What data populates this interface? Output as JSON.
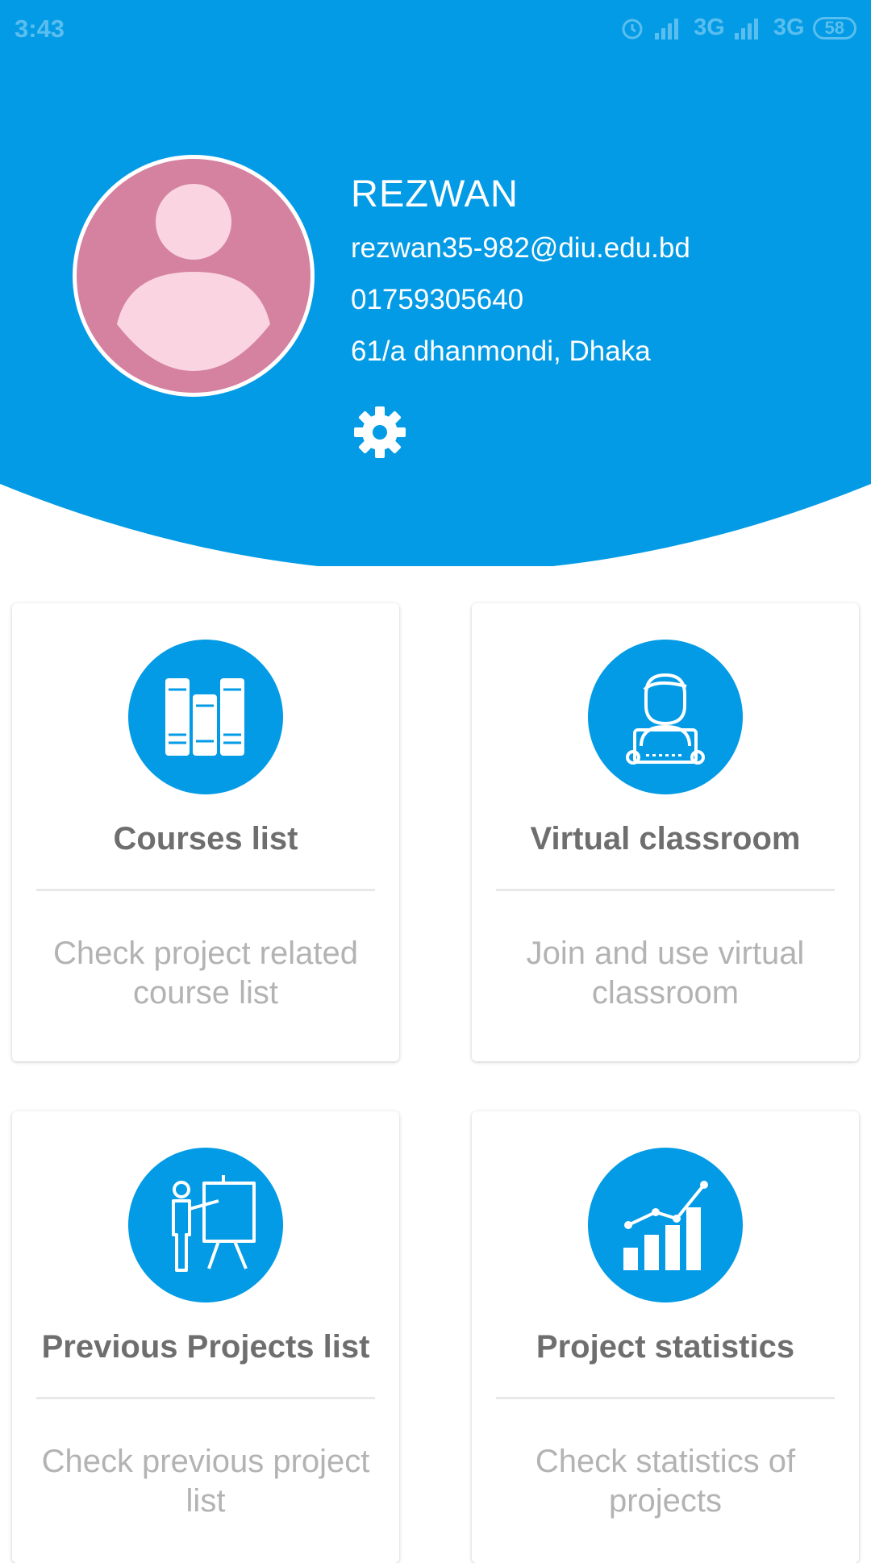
{
  "status_bar": {
    "time": "3:43",
    "network_1": "3G",
    "network_2": "3G",
    "battery": "58"
  },
  "profile": {
    "name": "REZWAN",
    "email": "rezwan35-982@diu.edu.bd",
    "phone": "01759305640",
    "address": "61/a dhanmondi, Dhaka"
  },
  "cards": [
    {
      "title": "Courses list",
      "description": "Check project related course list",
      "icon": "books-icon"
    },
    {
      "title": "Virtual classroom",
      "description": "Join and use virtual classroom",
      "icon": "student-laptop-icon"
    },
    {
      "title": "Previous Projects list",
      "description": "Check previous project list",
      "icon": "presentation-icon"
    },
    {
      "title": "Project statistics",
      "description": "Check statistics of projects",
      "icon": "bar-chart-icon"
    }
  ],
  "colors": {
    "primary": "#039be5",
    "avatar_bg": "#d4829f",
    "avatar_figure": "#fad4e1",
    "card_title": "#6e6e6e",
    "card_desc": "#b3b3b3"
  }
}
